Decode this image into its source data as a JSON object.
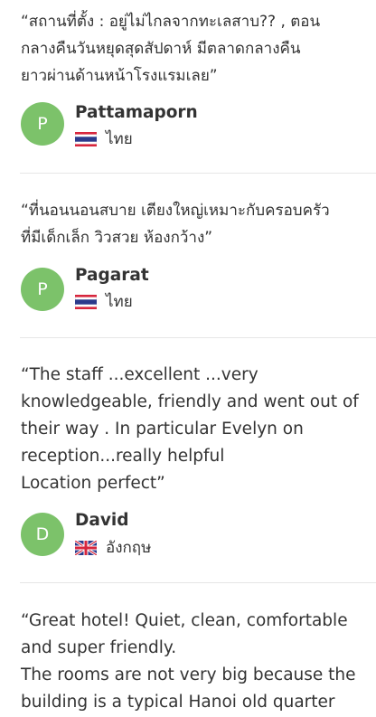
{
  "reviews": [
    {
      "quote_lines": [
        "“สถานที่ตั้ง : อยู่ไม่ไกลจากทะเลสาบ?? , ตอน",
        "กลางคืนวันหยุดสุดสัปดาห์ มีตลาดกลางคืน",
        "ยาวผ่านด้านหน้าโรงแรมเลย”"
      ],
      "avatar_letter": "P",
      "name": "Pattamaporn",
      "country": "ไทย",
      "flag": "thailand-flag-icon"
    },
    {
      "quote_lines": [
        "“ที่นอนนอนสบาย เตียงใหญ่เหมาะกับครอบครัว",
        "ที่มีเด็กเล็ก วิวสวย ห้องกว้าง”"
      ],
      "avatar_letter": "P",
      "name": "Pagarat",
      "country": "ไทย",
      "flag": "thailand-flag-icon"
    },
    {
      "quote_lines": [
        "“The staff ...excellent ...very",
        "knowledgeable, friendly and went out of",
        "their way . In particular Evelyn on",
        "reception...really helpful",
        "Location perfect”"
      ],
      "avatar_letter": "D",
      "name": "David",
      "country": "อังกฤษ",
      "flag": "uk-flag-icon"
    },
    {
      "quote_lines": [
        "“Great hotel! Quiet, clean, comfortable",
        "and super friendly.",
        "The rooms are not very big because the",
        "building is a typical Hanoi old quarter"
      ]
    }
  ],
  "colors": {
    "avatar": "#7cc26a",
    "text": "#333333",
    "divider": "#e6e6e6"
  }
}
